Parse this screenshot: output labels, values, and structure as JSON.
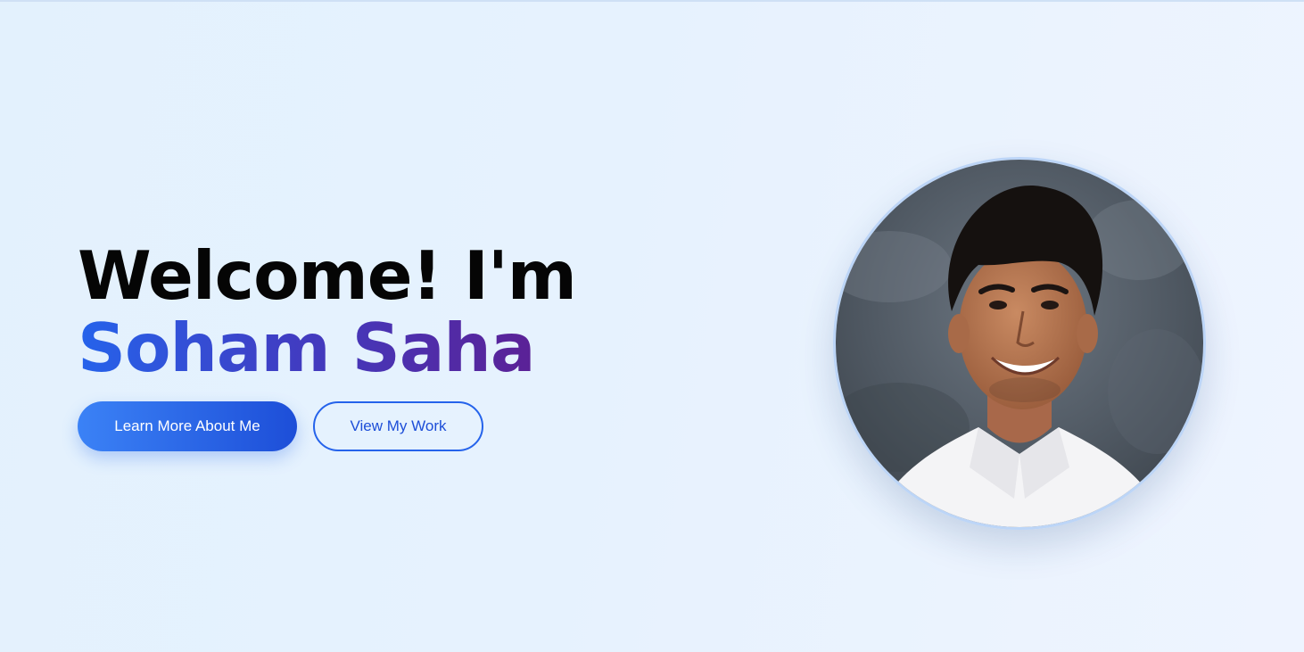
{
  "hero": {
    "title": "Welcome! I'm",
    "name": "Soham Saha"
  },
  "actions": {
    "primary_label": "Learn More About Me",
    "secondary_label": "View My Work"
  },
  "colors": {
    "primary": "#2563eb",
    "primary_dark": "#1d4ed8",
    "name_gradient_end": "#5b2196",
    "background": "#e6f2fe"
  },
  "portrait": {
    "icon": "profile-photo"
  }
}
